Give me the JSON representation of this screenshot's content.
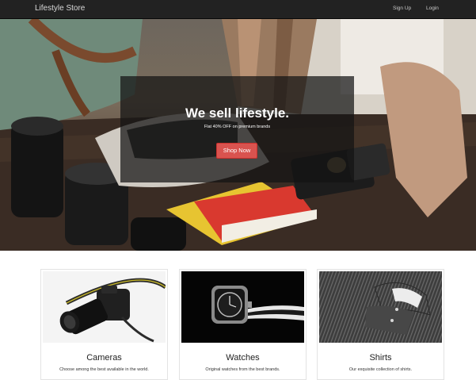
{
  "navbar": {
    "brand": "Lifestyle Store",
    "links": {
      "signup": "Sign Up",
      "login": "Login"
    }
  },
  "hero": {
    "title": "We sell lifestyle.",
    "subtitle": "Flat 40% OFF on premium brands",
    "button": "Shop Now",
    "button_color": "#d9534f"
  },
  "products": [
    {
      "title": "Cameras",
      "description": "Choose among the best available in the world.",
      "image": "dslr-camera-photo"
    },
    {
      "title": "Watches",
      "description": "Original watches from the best brands.",
      "image": "wrist-watch-photo"
    },
    {
      "title": "Shirts",
      "description": "Our exquisite collection of shirts.",
      "image": "folded-shirt-photo"
    }
  ]
}
